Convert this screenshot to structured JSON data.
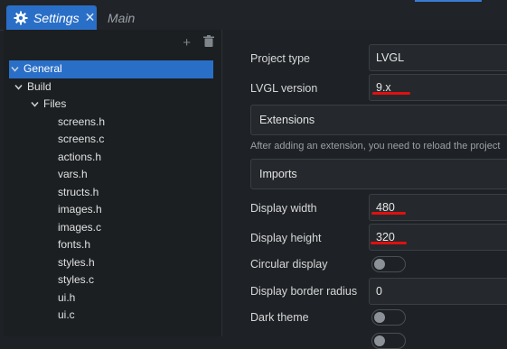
{
  "tabs": [
    {
      "label": "Settings",
      "icon": "gear-icon",
      "active": true,
      "close": "✕"
    },
    {
      "label": "Main",
      "active": false
    }
  ],
  "left_panel": {
    "toolbar": {
      "add": "+",
      "delete": "🗑"
    },
    "tree": [
      {
        "label": "General",
        "chevron": "v",
        "selected": true
      },
      {
        "label": "Build",
        "chevron": "v"
      },
      {
        "label": "Files",
        "chevron": "v"
      },
      {
        "label": "screens.h"
      },
      {
        "label": "screens.c"
      },
      {
        "label": "actions.h"
      },
      {
        "label": "vars.h"
      },
      {
        "label": "structs.h"
      },
      {
        "label": "images.h"
      },
      {
        "label": "images.c"
      },
      {
        "label": "fonts.h"
      },
      {
        "label": "styles.h"
      },
      {
        "label": "styles.c"
      },
      {
        "label": "ui.h"
      },
      {
        "label": "ui.c"
      }
    ]
  },
  "settings": {
    "project_type": {
      "label": "Project type",
      "value": "LVGL"
    },
    "lvgl_version": {
      "label": "LVGL version",
      "value": "9.x"
    },
    "extensions": {
      "label": "Extensions",
      "hint": "After adding an extension, you need to reload the project"
    },
    "imports": {
      "label": "Imports"
    },
    "display_width": {
      "label": "Display width",
      "value": "480"
    },
    "display_height": {
      "label": "Display height",
      "value": "320"
    },
    "circular_display": {
      "label": "Circular display",
      "on": false
    },
    "display_border_radius": {
      "label": "Display border radius",
      "value": "0"
    },
    "dark_theme": {
      "label": "Dark theme",
      "on": false
    }
  },
  "colors": {
    "accent": "#2a6fc7",
    "annotation": "#e01010"
  }
}
